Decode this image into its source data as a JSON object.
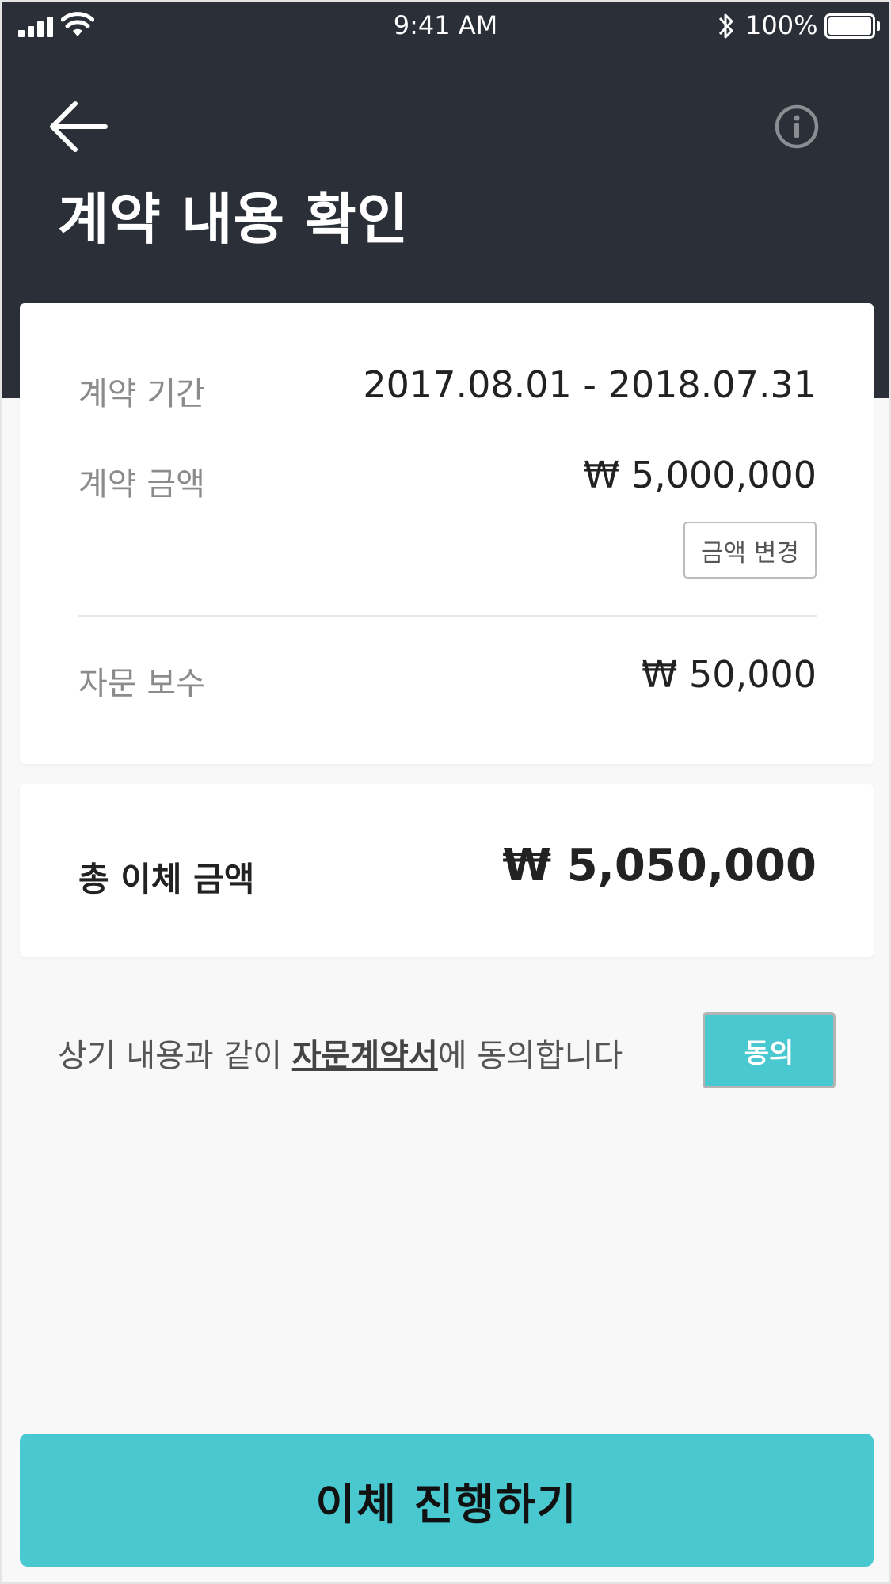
{
  "status_bar": {
    "time": "9:41 AM",
    "battery": "100%"
  },
  "header": {
    "title": "계약 내용 확인",
    "icons": {
      "back": "arrow-left-icon",
      "info": "info-circle-icon"
    },
    "background": "#2b3038"
  },
  "contract": {
    "period_label": "계약 기간",
    "period_value": "2017.08.01 - 2018.07.31",
    "amount_label": "계약 금액",
    "amount_value": "₩ 5,000,000",
    "change_amount_button": "금액 변경",
    "fee_label": "자문 보수",
    "fee_value": "₩ 50,000"
  },
  "total": {
    "label": "총 이체 금액",
    "value": "₩ 5,050,000"
  },
  "agreement": {
    "text_before": "상기 내용과 같이 ",
    "link": "자문계약서",
    "text_after": "에 동의합니다",
    "button": "동의"
  },
  "cta": {
    "label": "이체 진행하기"
  },
  "colors": {
    "accent": "#49c8cf",
    "header_bg": "#2b3038",
    "page_bg": "#f8f8f8"
  }
}
